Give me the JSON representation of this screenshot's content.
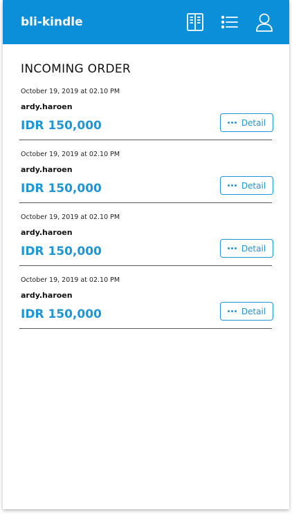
{
  "app": {
    "title": "bli-kindle"
  },
  "header": {
    "icons": [
      "book-icon",
      "list-icon",
      "user-icon"
    ]
  },
  "page": {
    "title": "INCOMING ORDER"
  },
  "orders": [
    {
      "date": "October 19, 2019 at 02.10 PM",
      "user": "ardy.haroen",
      "price": "IDR 150,000",
      "button_label": "Detail"
    },
    {
      "date": "October 19, 2019 at 02.10 PM",
      "user": "ardy.haroen",
      "price": "IDR 150,000",
      "button_label": "Detail"
    },
    {
      "date": "October 19, 2019 at 02.10 PM",
      "user": "ardy.haroen",
      "price": "IDR 150,000",
      "button_label": "Detail"
    },
    {
      "date": "October 19, 2019 at 02.10 PM",
      "user": "ardy.haroen",
      "price": "IDR 150,000",
      "button_label": "Detail"
    }
  ],
  "colors": {
    "header": "#0b8fd8",
    "accent": "#1e96d6",
    "divider": "#555555"
  }
}
